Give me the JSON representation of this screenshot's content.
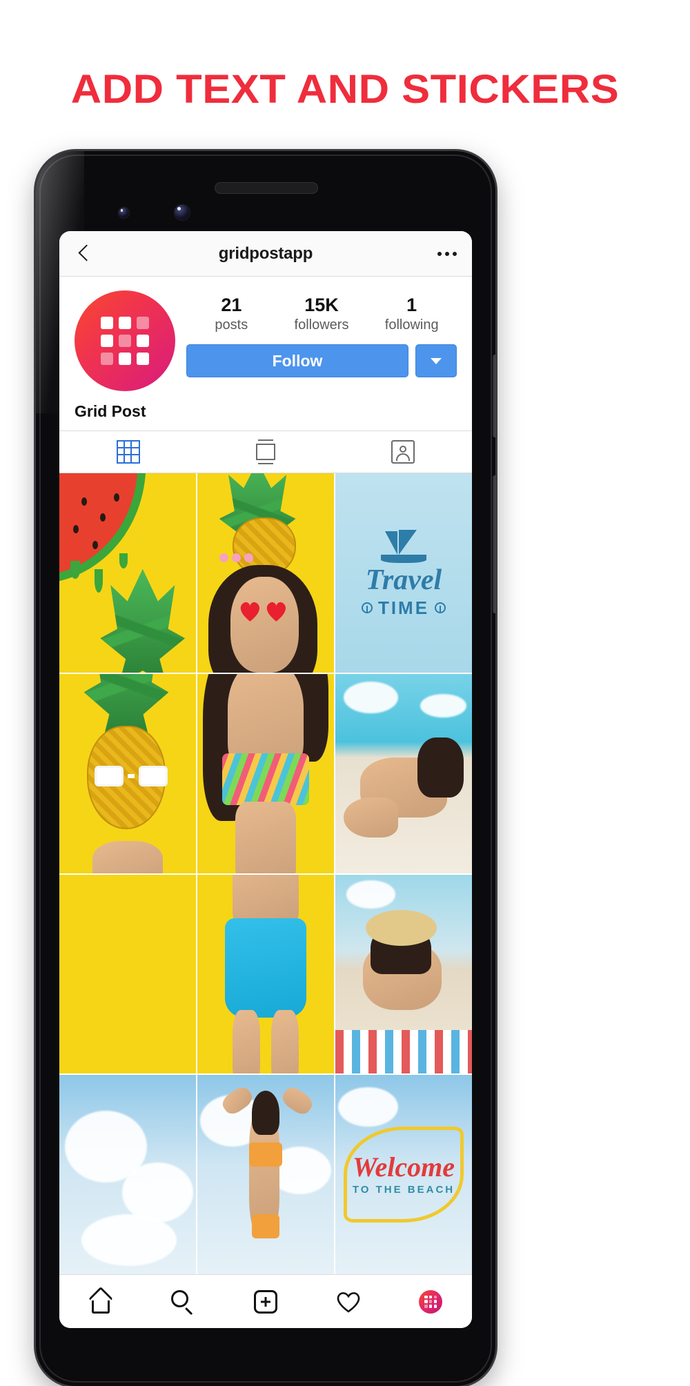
{
  "headline": "ADD TEXT AND STICKERS",
  "accent_color": "#ef2d3c",
  "phone": {
    "appbar": {
      "back_icon": "chevron-left-icon",
      "title": "gridpostapp",
      "more_icon": "more-options-icon"
    },
    "profile": {
      "avatar_icon": "grid-logo-avatar",
      "avatar_gradient_from": "#f8482f",
      "avatar_gradient_to": "#d81b7e",
      "stats": [
        {
          "value": "21",
          "label": "posts"
        },
        {
          "value": "15K",
          "label": "followers"
        },
        {
          "value": "1",
          "label": "following"
        }
      ],
      "follow_label": "Follow",
      "follow_color": "#4d94ec",
      "dropdown_icon": "chevron-down-icon",
      "display_name": "Grid Post"
    },
    "tabs": [
      {
        "name": "grid",
        "icon": "grid-tab-icon",
        "active": true,
        "color": "#2b6fd6"
      },
      {
        "name": "carousel",
        "icon": "carousel-tab-icon",
        "active": false,
        "color": "#6b6b6b"
      },
      {
        "name": "tagged",
        "icon": "tagged-person-tab-icon",
        "active": false,
        "color": "#6b6b6b"
      }
    ],
    "photo_grid": {
      "columns": 3,
      "rows": 4,
      "cells": [
        {
          "id": "r1c1",
          "description": "watermelon slice on yellow",
          "bg": "#f6d516"
        },
        {
          "id": "r1c2",
          "description": "woman with pineapple hat on yellow",
          "bg": "#f6d516"
        },
        {
          "id": "r1c3",
          "description": "Travel TIME sailboat graphic",
          "bg": "#a8d8ea",
          "text_script": "Travel",
          "text_block": "TIME"
        },
        {
          "id": "r2c1",
          "description": "pineapple with sunglasses on yellow",
          "bg": "#f6d516"
        },
        {
          "id": "r2c2",
          "description": "woman in striped bikini top on yellow",
          "bg": "#f6d516"
        },
        {
          "id": "r2c3",
          "description": "woman sunbathing on beach",
          "bg": "#4cc2de"
        },
        {
          "id": "r3c1",
          "description": "yellow background",
          "bg": "#f6d516"
        },
        {
          "id": "r3c2",
          "description": "woman in blue high-waist shorts on yellow",
          "bg": "#f6d516"
        },
        {
          "id": "r3c3",
          "description": "woman in straw hat lying on beach towel",
          "bg": "#9fd8ea"
        },
        {
          "id": "r4c1",
          "description": "clouds and sky",
          "bg": "#cfe6f3"
        },
        {
          "id": "r4c2",
          "description": "woman in orange bikini arms raised",
          "bg": "#cfe6f3"
        },
        {
          "id": "r4c3",
          "description": "Welcome to the beach surfboard sign",
          "bg": "#cfe6f3",
          "text_script": "Welcome",
          "text_sub": "TO THE BEACH"
        }
      ]
    },
    "bottom_nav": [
      {
        "name": "home",
        "icon": "home-icon"
      },
      {
        "name": "search",
        "icon": "search-icon"
      },
      {
        "name": "add-post",
        "icon": "plus-square-icon"
      },
      {
        "name": "activity",
        "icon": "heart-icon"
      },
      {
        "name": "profile",
        "icon": "profile-avatar-icon"
      }
    ]
  }
}
